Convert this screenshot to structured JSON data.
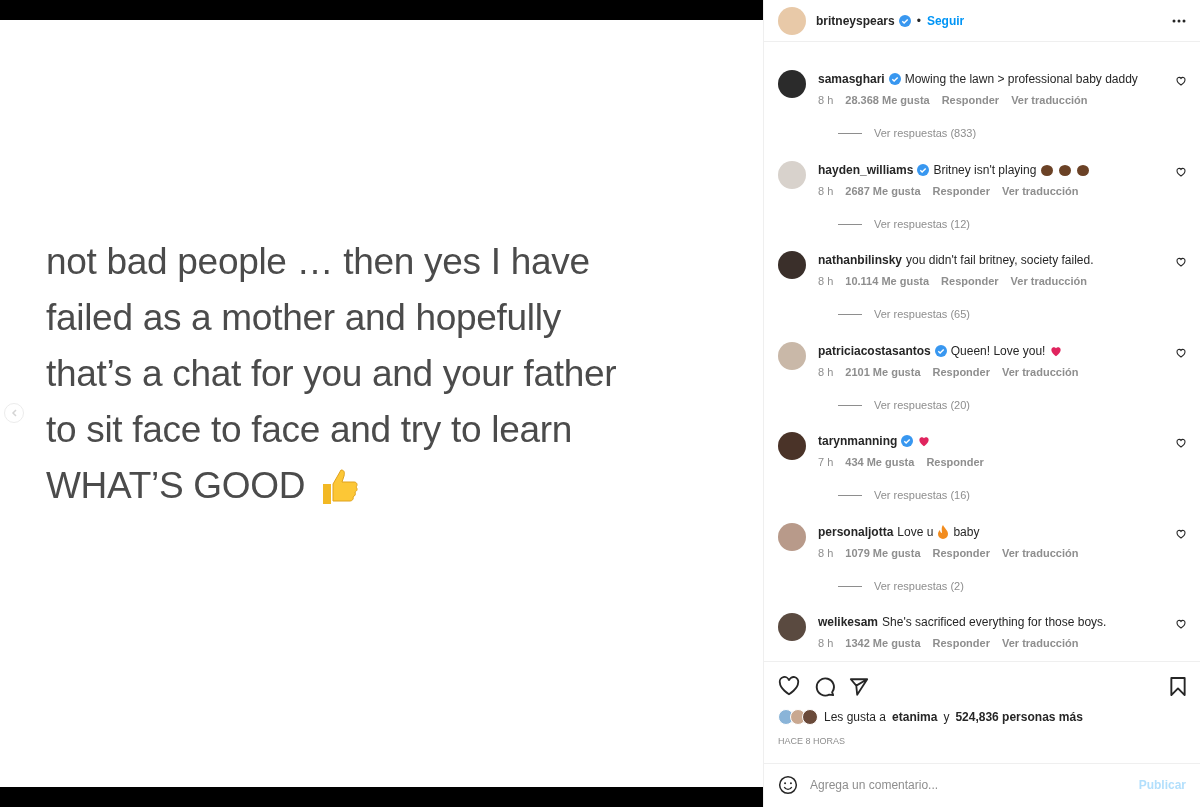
{
  "post_image": {
    "lines": [
      "not bad people … then yes I have",
      "failed as a mother and hopefully",
      "that’s a chat for you and your father",
      "to sit face to face and try to learn",
      "WHAT’S GOOD"
    ]
  },
  "header": {
    "username": "britneyspears",
    "verified": true,
    "separator": "•",
    "follow": "Seguir"
  },
  "comments": [
    {
      "user": "samasghari",
      "verified": true,
      "parts": [
        {
          "kind": "text",
          "text": "Mowing the lawn > professional baby daddy"
        }
      ],
      "time": "8 h",
      "likes": "28.368 Me gusta",
      "reply": "Responder",
      "translate": "Ver traducción",
      "replies": "Ver respuestas (833)"
    },
    {
      "user": "hayden_williams",
      "verified": true,
      "parts": [
        {
          "kind": "text",
          "text": "Britney isn't playing"
        },
        {
          "kind": "clap"
        },
        {
          "kind": "clap"
        },
        {
          "kind": "clap"
        }
      ],
      "time": "8 h",
      "likes": "2687 Me gusta",
      "reply": "Responder",
      "translate": "Ver traducción",
      "replies": "Ver respuestas (12)"
    },
    {
      "user": "nathanbilinsky",
      "verified": false,
      "parts": [
        {
          "kind": "text",
          "text": "you didn't fail britney, society failed."
        }
      ],
      "time": "8 h",
      "likes": "10.114 Me gusta",
      "reply": "Responder",
      "translate": "Ver traducción",
      "replies": "Ver respuestas (65)"
    },
    {
      "user": "patriciacostasantos",
      "verified": true,
      "parts": [
        {
          "kind": "text",
          "text": "Queen! Love you!"
        },
        {
          "kind": "heart"
        }
      ],
      "time": "8 h",
      "likes": "2101 Me gusta",
      "reply": "Responder",
      "translate": "Ver traducción",
      "replies": "Ver respuestas (20)"
    },
    {
      "user": "tarynmanning",
      "verified": true,
      "parts": [
        {
          "kind": "heart"
        }
      ],
      "time": "7 h",
      "likes": "434 Me gusta",
      "reply": "Responder",
      "replies": "Ver respuestas (16)"
    },
    {
      "user": "personaljotta",
      "verified": false,
      "parts": [
        {
          "kind": "text",
          "text": "Love u"
        },
        {
          "kind": "fire"
        },
        {
          "kind": "text",
          "text": "baby"
        }
      ],
      "time": "8 h",
      "likes": "1079 Me gusta",
      "reply": "Responder",
      "translate": "Ver traducción",
      "replies": "Ver respuestas (2)"
    },
    {
      "user": "welikesam",
      "verified": false,
      "parts": [
        {
          "kind": "text",
          "text": "She's sacrificed everything for those boys."
        }
      ],
      "time": "8 h",
      "likes": "1342 Me gusta",
      "reply": "Responder",
      "translate": "Ver traducción"
    }
  ],
  "likes_line": {
    "prefix": "Les gusta a",
    "user": "etanima",
    "joiner": "y",
    "rest": "524,836 personas más"
  },
  "timestamp": "HACE 8 HORAS",
  "comment_box": {
    "placeholder": "Agrega un comentario...",
    "submit": "Publicar"
  }
}
